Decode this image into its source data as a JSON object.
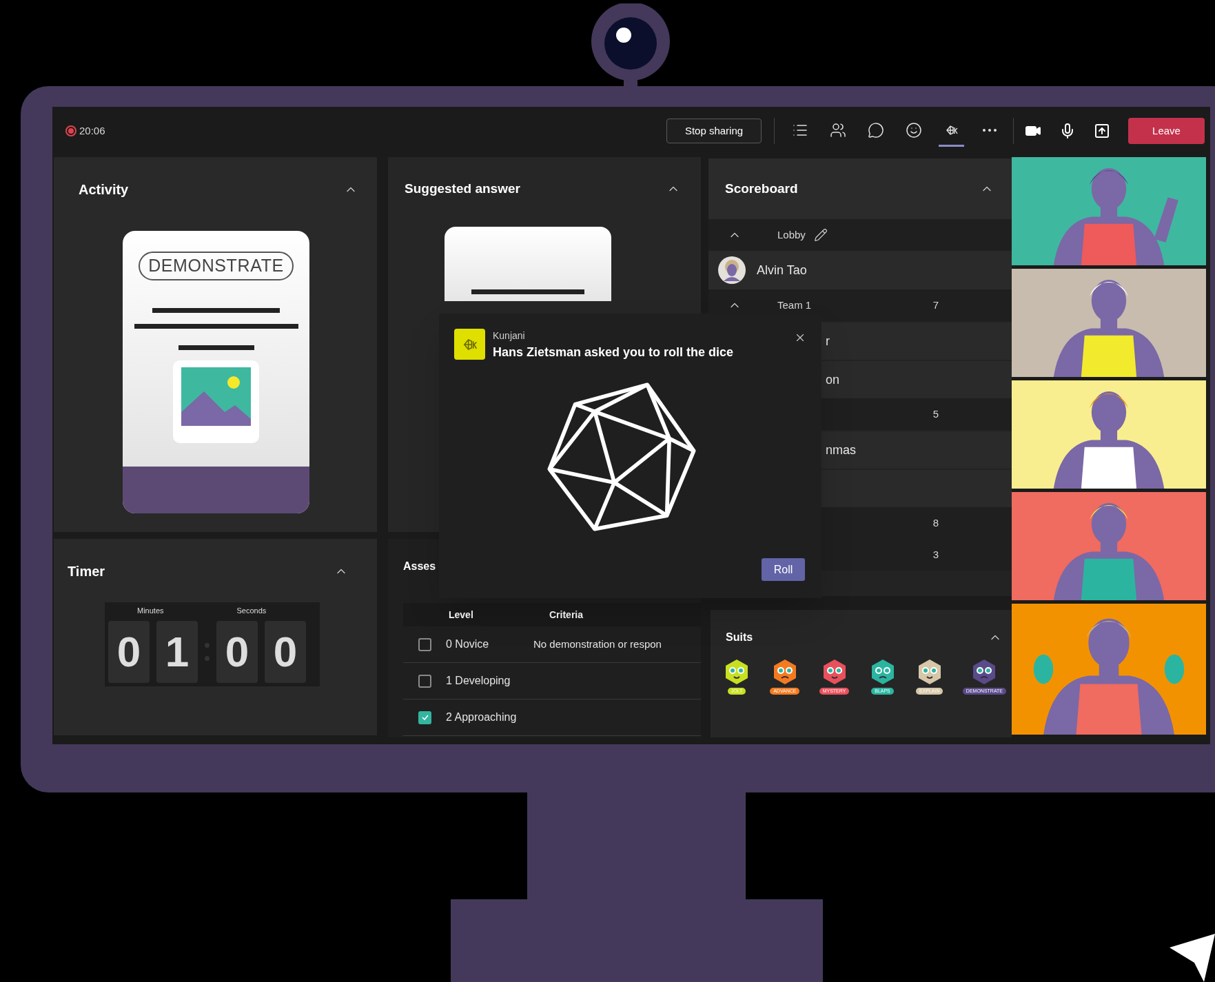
{
  "call": {
    "recording": true,
    "time": "20:06"
  },
  "toolbar": {
    "stop_sharing": "Stop sharing",
    "buttons": [
      {
        "kind": "list",
        "selected": false
      },
      {
        "kind": "people",
        "selected": false
      },
      {
        "kind": "chat",
        "selected": false
      },
      {
        "kind": "reactions",
        "selected": false
      },
      {
        "kind": "app",
        "selected": true
      },
      {
        "kind": "more",
        "selected": false
      }
    ],
    "devices": [
      {
        "kind": "camera"
      },
      {
        "kind": "mic"
      },
      {
        "kind": "share"
      }
    ],
    "leave": "Leave"
  },
  "activity": {
    "title": "Activity",
    "expanded": true,
    "card_label": "DEMONSTRATE"
  },
  "timer": {
    "title": "Timer",
    "expanded": true,
    "minutes_label": "Minutes",
    "seconds_label": "Seconds",
    "digits": [
      "0",
      "1",
      "0",
      "0"
    ]
  },
  "suggested_answer": {
    "title": "Suggested answer",
    "expanded": true
  },
  "assessment": {
    "title": "Asses",
    "columns": [
      "Level",
      "Criteria"
    ],
    "rows": [
      {
        "level": "0 Novice",
        "criteria": "No demonstration or respon",
        "checked": false
      },
      {
        "level": "1 Developing",
        "checked": false
      },
      {
        "level": "2 Approaching",
        "checked": true
      }
    ]
  },
  "scoreboard": {
    "title": "Scoreboard",
    "expanded": true,
    "rows": [
      {
        "kind": "group",
        "name": "Lobby",
        "expanded": true,
        "editable": true
      },
      {
        "kind": "player",
        "name": "Alvin Tao"
      },
      {
        "kind": "group",
        "name": "Team 1",
        "score": "7",
        "expanded": true
      },
      {
        "kind": "member",
        "name": "r"
      },
      {
        "kind": "member",
        "name": "on"
      },
      {
        "kind": "group",
        "score": "5"
      },
      {
        "kind": "member",
        "name": "nmas"
      },
      {
        "kind": "member"
      },
      {
        "kind": "group",
        "score": "8"
      },
      {
        "kind": "group",
        "score": "3"
      }
    ]
  },
  "suits": {
    "title": "Suits",
    "expanded": true,
    "items": [
      {
        "label": "JOLT",
        "color": "#c8e021"
      },
      {
        "label": "ADVANCE",
        "color": "#f47a20"
      },
      {
        "label": "MYSTERY",
        "color": "#e8505b"
      },
      {
        "label": "BLAPS",
        "color": "#2bb5a0"
      },
      {
        "label": "EXPLAIN",
        "color": "#d6c7a8"
      },
      {
        "label": "DEMONSTRATE",
        "color": "#5a4a8a"
      }
    ]
  },
  "notification": {
    "app": "Kunjani",
    "message": "Hans Zietsman asked you to roll the dice",
    "button": "Roll"
  }
}
